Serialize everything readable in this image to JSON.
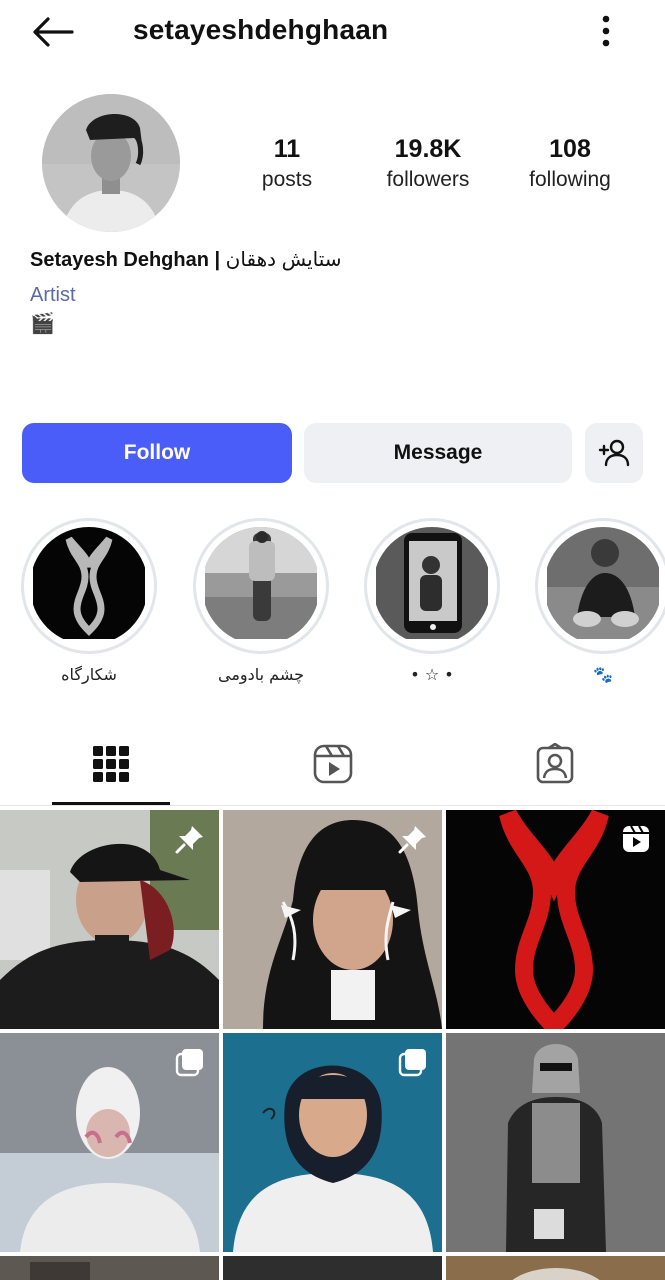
{
  "header": {
    "username": "setayeshdehghaan"
  },
  "stats": [
    {
      "value": "11",
      "label": "posts"
    },
    {
      "value": "19.8K",
      "label": "followers"
    },
    {
      "value": "108",
      "label": "following"
    }
  ],
  "profile": {
    "name_en": "Setayesh Dehghan |",
    "name_fa": "ستایش دهقان",
    "category": "Artist",
    "bio_emoji": "🎬"
  },
  "buttons": {
    "follow": "Follow",
    "message": "Message"
  },
  "highlights": [
    {
      "label": "شکارگاه"
    },
    {
      "label": "چشم بادومی"
    },
    {
      "label": "• ☆ •"
    },
    {
      "label": "🐾"
    }
  ],
  "tabs": [
    "posts-grid",
    "reels",
    "tagged"
  ],
  "colors": {
    "accent": "#4a5df9",
    "button_secondary": "#eef0f3",
    "category_text": "#5a6aa8"
  }
}
